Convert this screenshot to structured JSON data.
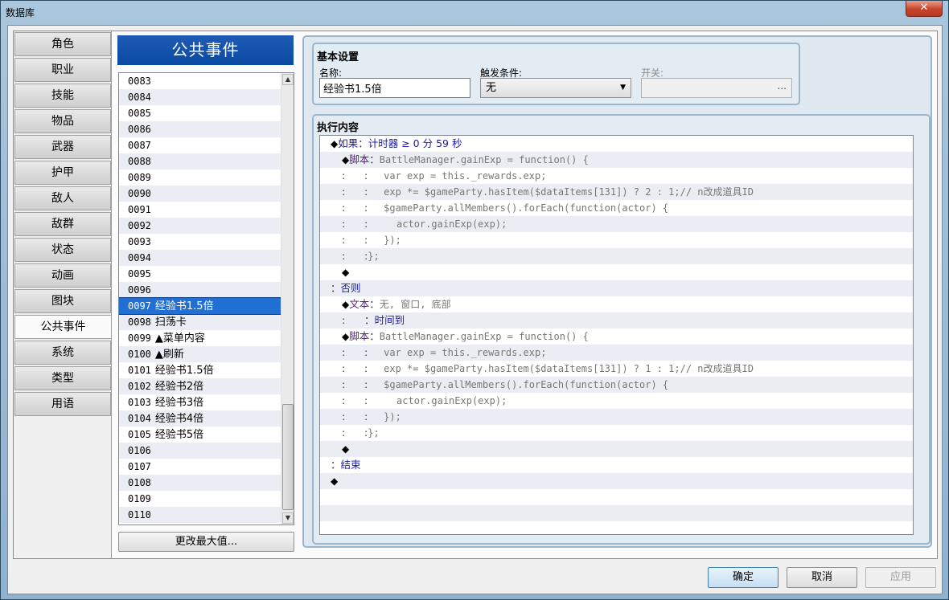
{
  "window": {
    "title": "数据库",
    "close_glyph": "✕"
  },
  "tabs": [
    {
      "label": "角色"
    },
    {
      "label": "职业"
    },
    {
      "label": "技能"
    },
    {
      "label": "物品"
    },
    {
      "label": "武器"
    },
    {
      "label": "护甲"
    },
    {
      "label": "敌人"
    },
    {
      "label": "敌群"
    },
    {
      "label": "状态"
    },
    {
      "label": "动画"
    },
    {
      "label": "图块"
    },
    {
      "label": "公共事件",
      "active": true
    },
    {
      "label": "系统"
    },
    {
      "label": "类型"
    },
    {
      "label": "用语"
    }
  ],
  "list": {
    "header": "公共事件",
    "rows": [
      {
        "num": "0083",
        "name": ""
      },
      {
        "num": "0084",
        "name": ""
      },
      {
        "num": "0085",
        "name": ""
      },
      {
        "num": "0086",
        "name": ""
      },
      {
        "num": "0087",
        "name": ""
      },
      {
        "num": "0088",
        "name": ""
      },
      {
        "num": "0089",
        "name": ""
      },
      {
        "num": "0090",
        "name": ""
      },
      {
        "num": "0091",
        "name": ""
      },
      {
        "num": "0092",
        "name": ""
      },
      {
        "num": "0093",
        "name": ""
      },
      {
        "num": "0094",
        "name": ""
      },
      {
        "num": "0095",
        "name": ""
      },
      {
        "num": "0096",
        "name": ""
      },
      {
        "num": "0097",
        "name": "经验书1.5倍",
        "selected": true
      },
      {
        "num": "0098",
        "name": "扫荡卡"
      },
      {
        "num": "0099",
        "name": "▲菜单内容"
      },
      {
        "num": "0100",
        "name": "▲刷新"
      },
      {
        "num": "0101",
        "name": "经验书1.5倍"
      },
      {
        "num": "0102",
        "name": "经验书2倍"
      },
      {
        "num": "0103",
        "name": "经验书3倍"
      },
      {
        "num": "0104",
        "name": "经验书4倍"
      },
      {
        "num": "0105",
        "name": "经验书5倍"
      },
      {
        "num": "0106",
        "name": ""
      },
      {
        "num": "0107",
        "name": ""
      },
      {
        "num": "0108",
        "name": ""
      },
      {
        "num": "0109",
        "name": ""
      },
      {
        "num": "0110",
        "name": ""
      }
    ],
    "change_max_label": "更改最大值..."
  },
  "basic": {
    "group_label": "基本设置",
    "name_label": "名称:",
    "name_value": "经验书1.5倍",
    "trigger_label": "触发条件:",
    "trigger_value": "无",
    "switch_label": "开关:",
    "switch_dots": "..."
  },
  "exec": {
    "group_label": "执行内容",
    "lines": [
      {
        "indent": 1,
        "parts": [
          [
            "b",
            "◆"
          ],
          [
            "k",
            "如果"
          ],
          [
            "c",
            "："
          ],
          [
            "k",
            "计时器 ≥ 0 分 59 秒"
          ]
        ]
      },
      {
        "indent": 2,
        "parts": [
          [
            "b",
            "◆"
          ],
          [
            "s",
            "脚本"
          ],
          [
            "c",
            "："
          ],
          [
            "t",
            "BattleManager.gainExp = function() {"
          ]
        ]
      },
      {
        "indent": 2,
        "parts": [
          [
            "c",
            ":      :     "
          ],
          [
            "t",
            "var exp = this._rewards.exp;"
          ]
        ]
      },
      {
        "indent": 2,
        "parts": [
          [
            "c",
            ":      :     "
          ],
          [
            "t",
            "exp *= $gameParty.hasItem($dataItems[131]) ? 2 : 1;// n改成道具ID"
          ]
        ]
      },
      {
        "indent": 2,
        "parts": [
          [
            "c",
            ":      :     "
          ],
          [
            "t",
            "$gameParty.allMembers().forEach(function(actor) {"
          ]
        ]
      },
      {
        "indent": 2,
        "parts": [
          [
            "c",
            ":      :         "
          ],
          [
            "t",
            "actor.gainExp(exp);"
          ]
        ]
      },
      {
        "indent": 2,
        "parts": [
          [
            "c",
            ":      :     "
          ],
          [
            "t",
            "});"
          ]
        ]
      },
      {
        "indent": 2,
        "parts": [
          [
            "c",
            ":      :"
          ],
          [
            "t",
            "};"
          ]
        ]
      },
      {
        "indent": 2,
        "parts": [
          [
            "b",
            "◆"
          ]
        ]
      },
      {
        "indent": 1,
        "parts": [
          [
            "c",
            "："
          ],
          [
            "k",
            "否则"
          ]
        ]
      },
      {
        "indent": 2,
        "parts": [
          [
            "b",
            "◆"
          ],
          [
            "s",
            "文本"
          ],
          [
            "c",
            "："
          ],
          [
            "t",
            "无, 窗口, 底部"
          ]
        ]
      },
      {
        "indent": 2,
        "parts": [
          [
            "c",
            ":      ："
          ],
          [
            "k",
            "时间到"
          ]
        ]
      },
      {
        "indent": 2,
        "parts": [
          [
            "b",
            "◆"
          ],
          [
            "s",
            "脚本"
          ],
          [
            "c",
            "："
          ],
          [
            "t",
            "BattleManager.gainExp = function() {"
          ]
        ]
      },
      {
        "indent": 2,
        "parts": [
          [
            "c",
            ":      :     "
          ],
          [
            "t",
            "var exp = this._rewards.exp;"
          ]
        ]
      },
      {
        "indent": 2,
        "parts": [
          [
            "c",
            ":      :     "
          ],
          [
            "t",
            "exp *= $gameParty.hasItem($dataItems[131]) ? 1 : 1;// n改成道具ID"
          ]
        ]
      },
      {
        "indent": 2,
        "parts": [
          [
            "c",
            ":      :     "
          ],
          [
            "t",
            "$gameParty.allMembers().forEach(function(actor) {"
          ]
        ]
      },
      {
        "indent": 2,
        "parts": [
          [
            "c",
            ":      :         "
          ],
          [
            "t",
            "actor.gainExp(exp);"
          ]
        ]
      },
      {
        "indent": 2,
        "parts": [
          [
            "c",
            ":      :     "
          ],
          [
            "t",
            "});"
          ]
        ]
      },
      {
        "indent": 2,
        "parts": [
          [
            "c",
            ":      :"
          ],
          [
            "t",
            "};"
          ]
        ]
      },
      {
        "indent": 2,
        "parts": [
          [
            "b",
            "◆"
          ]
        ]
      },
      {
        "indent": 1,
        "parts": [
          [
            "c",
            "："
          ],
          [
            "k",
            "结束"
          ]
        ]
      },
      {
        "indent": 1,
        "parts": [
          [
            "b",
            "◆"
          ]
        ]
      },
      {
        "indent": 0,
        "parts": []
      },
      {
        "indent": 0,
        "parts": []
      },
      {
        "indent": 0,
        "parts": []
      }
    ]
  },
  "footer": {
    "ok": "确定",
    "cancel": "取消",
    "apply": "应用"
  }
}
